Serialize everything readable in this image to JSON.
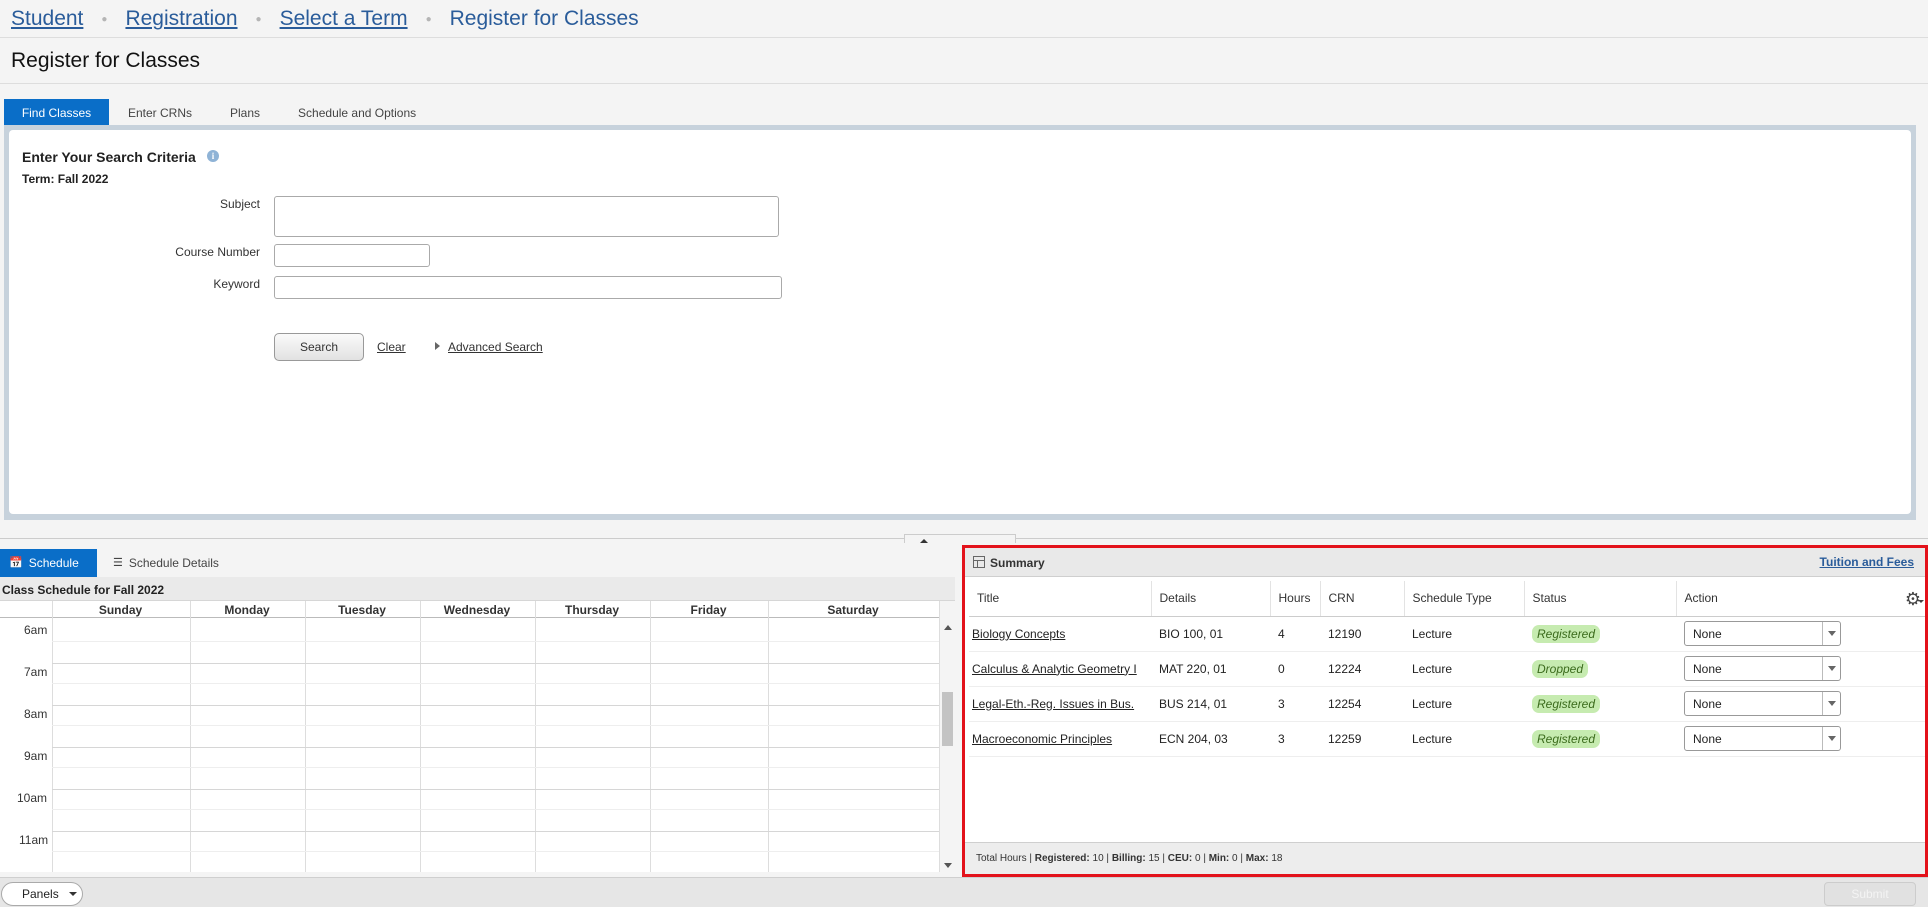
{
  "breadcrumb": {
    "items": [
      "Student",
      "Registration",
      "Select a Term"
    ],
    "current": "Register for Classes"
  },
  "page_title": "Register for Classes",
  "top_tabs": [
    "Find Classes",
    "Enter CRNs",
    "Plans",
    "Schedule and Options"
  ],
  "search": {
    "title": "Enter Your Search Criteria",
    "term": "Term: Fall 2022",
    "subject_label": "Subject",
    "course_number_label": "Course Number",
    "keyword_label": "Keyword",
    "search_button": "Search",
    "clear_link": "Clear",
    "advanced_link": "Advanced Search"
  },
  "schedule": {
    "tabs": [
      "Schedule",
      "Schedule Details"
    ],
    "header": "Class Schedule for Fall 2022",
    "days": [
      "Sunday",
      "Monday",
      "Tuesday",
      "Wednesday",
      "Thursday",
      "Friday",
      "Saturday"
    ],
    "hours": [
      "6am",
      "7am",
      "8am",
      "9am",
      "10am",
      "11am"
    ]
  },
  "summary": {
    "title": "Summary",
    "tuition_link": "Tuition and Fees",
    "columns": [
      "Title",
      "Details",
      "Hours",
      "CRN",
      "Schedule Type",
      "Status",
      "Action"
    ],
    "rows": [
      {
        "title": "Biology Concepts",
        "details": "BIO 100, 01",
        "hours": "4",
        "crn": "12190",
        "type": "Lecture",
        "status": "Registered",
        "action": "None"
      },
      {
        "title": "Calculus & Analytic Geometry I",
        "details": "MAT 220, 01",
        "hours": "0",
        "crn": "12224",
        "type": "Lecture",
        "status": "Dropped",
        "action": "None"
      },
      {
        "title": "Legal-Eth.-Reg. Issues in Bus.",
        "details": "BUS 214, 01",
        "hours": "3",
        "crn": "12254",
        "type": "Lecture",
        "status": "Registered",
        "action": "None"
      },
      {
        "title": "Macroeconomic Principles",
        "details": "ECN 204, 03",
        "hours": "3",
        "crn": "12259",
        "type": "Lecture",
        "status": "Registered",
        "action": "None"
      }
    ],
    "footer": {
      "total_label": "Total Hours",
      "registered_label": "Registered:",
      "registered": "10",
      "billing_label": "Billing:",
      "billing": "15",
      "ceu_label": "CEU:",
      "ceu": "0",
      "min_label": "Min:",
      "min": "0",
      "max_label": "Max:",
      "max": "18"
    }
  },
  "bottom": {
    "panels": "Panels",
    "submit": "Submit"
  },
  "colors": {
    "accent": "#0a6ec8",
    "link": "#2a5c9a",
    "highlight_border": "#e3121b",
    "status_bg": "#c6ebb0"
  }
}
